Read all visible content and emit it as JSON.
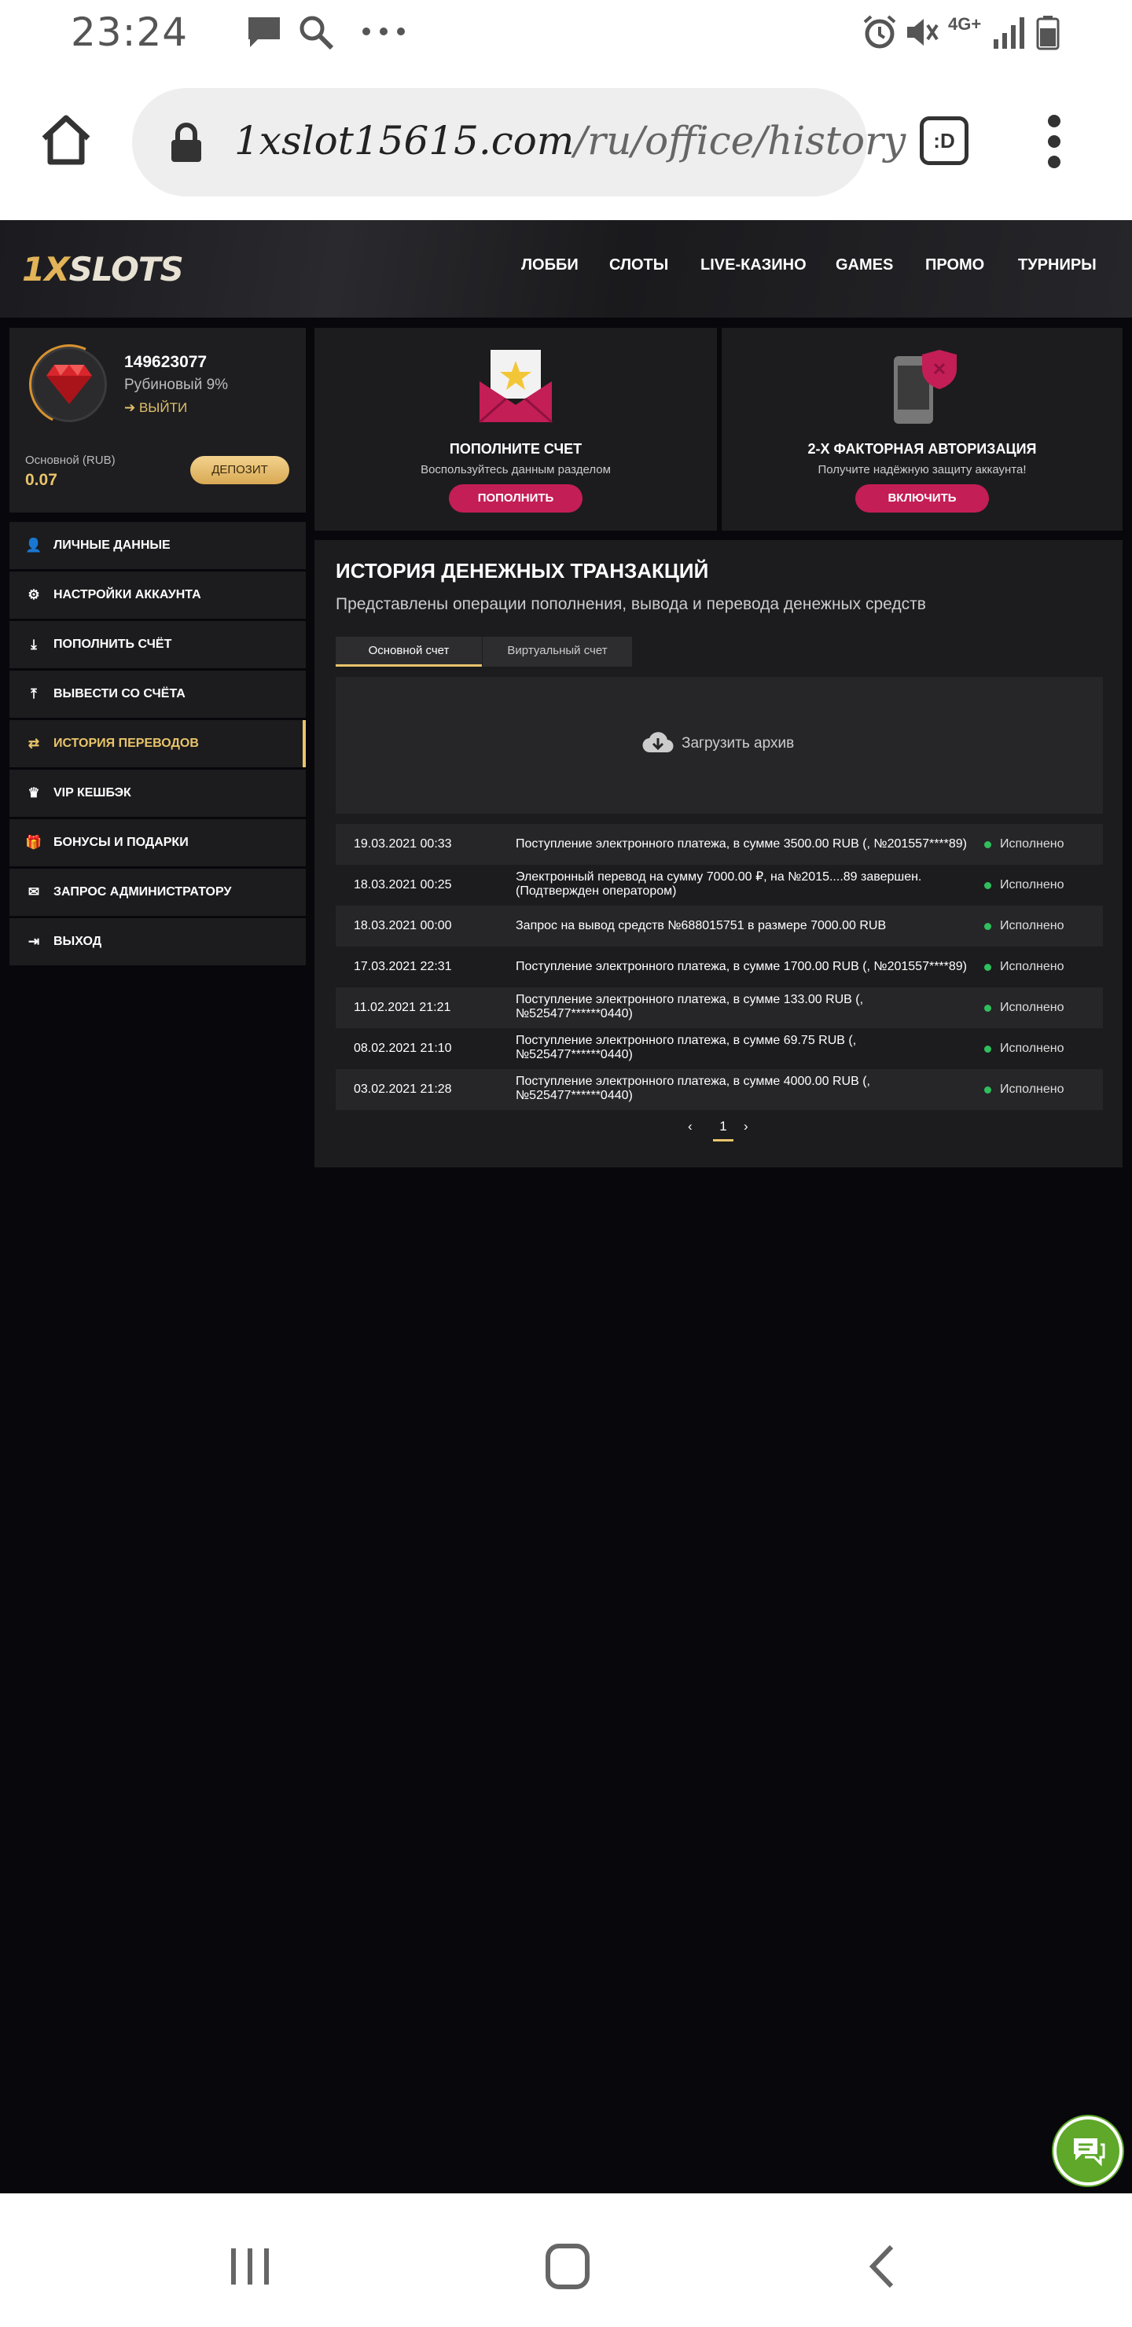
{
  "status_bar": {
    "time": "23:24",
    "network": "4G+"
  },
  "browser": {
    "url_host": "1xslot15615.com",
    "url_path": "/ru/office/history",
    "tab_icon": ":D"
  },
  "site": {
    "logo": {
      "prefix": "1X",
      "suffix": "SLOTS"
    },
    "nav": [
      "ЛОББИ",
      "СЛОТЫ",
      "LIVE-КАЗИНО",
      "GAMES",
      "ПРОМО",
      "ТУРНИРЫ"
    ],
    "accent_color": "#e8c46a",
    "button_color": "#c31e55",
    "success_color": "#2fbf5c"
  },
  "profile": {
    "user_id": "149623077",
    "rank": "Рубиновый 9%",
    "logout": "ВЫЙТИ",
    "balance_label": "Основной (RUB)",
    "balance_value": "0.07",
    "deposit_button": "ДЕПОЗИТ"
  },
  "menu": [
    {
      "label": "ЛИЧНЫЕ ДАННЫЕ",
      "icon": "user-plus-icon"
    },
    {
      "label": "НАСТРОЙКИ АККАУНТА",
      "icon": "gears-icon"
    },
    {
      "label": "ПОПОЛНИТЬ СЧЁТ",
      "icon": "download-icon"
    },
    {
      "label": "ВЫВЕСТИ СО СЧЁТА",
      "icon": "upload-icon"
    },
    {
      "label": "ИСТОРИЯ ПЕРЕВОДОВ",
      "icon": "exchange-icon",
      "active": true
    },
    {
      "label": "VIP КЕШБЭК",
      "icon": "crown-icon"
    },
    {
      "label": "БОНУСЫ И ПОДАРКИ",
      "icon": "gift-icon"
    },
    {
      "label": "ЗАПРОС АДМИНИСТРАТОРУ",
      "icon": "envelope-icon"
    },
    {
      "label": "ВЫХОД",
      "icon": "sign-out-icon"
    }
  ],
  "cards": {
    "deposit": {
      "title": "ПОПОЛНИТЕ СЧЕТ",
      "subtitle": "Воспользуйтесь данным разделом",
      "button": "ПОПОЛНИТЬ"
    },
    "twofa": {
      "title": "2-Х ФАКТОРНАЯ АВТОРИЗАЦИЯ",
      "subtitle": "Получите надёжную защиту аккаунта!",
      "button": "ВКЛЮЧИТЬ"
    }
  },
  "history": {
    "title": "ИСТОРИЯ ДЕНЕЖНЫХ ТРАНЗАКЦИЙ",
    "subtitle": "Представлены операции пополнения, вывода и перевода денежных средств",
    "tabs": [
      "Основной счет",
      "Виртуальный счет"
    ],
    "archive": "Загрузить архив",
    "rows": [
      {
        "date": "19.03.2021 00:33",
        "desc": "Поступление электронного платежа, в сумме 3500.00 RUB (, №201557****89)",
        "status": "Исполнено"
      },
      {
        "date": "18.03.2021 00:25",
        "desc": "Электронный перевод на сумму 7000.00 ₽, на №2015....89 завершен. (Подтвержден оператором)",
        "status": "Исполнено"
      },
      {
        "date": "18.03.2021 00:00",
        "desc": "Запрос на вывод средств №688015751 в размере 7000.00 RUB",
        "status": "Исполнено"
      },
      {
        "date": "17.03.2021 22:31",
        "desc": "Поступление электронного платежа, в сумме 1700.00 RUB (, №201557****89)",
        "status": "Исполнено"
      },
      {
        "date": "11.02.2021 21:21",
        "desc": "Поступление электронного платежа, в сумме 133.00 RUB (, №525477******0440)",
        "status": "Исполнено"
      },
      {
        "date": "08.02.2021 21:10",
        "desc": "Поступление электронного платежа, в сумме 69.75 RUB (, №525477******0440)",
        "status": "Исполнено"
      },
      {
        "date": "03.02.2021 21:28",
        "desc": "Поступление электронного платежа, в сумме 4000.00 RUB (, №525477******0440)",
        "status": "Исполнено"
      }
    ],
    "pager": {
      "prev": "‹",
      "page": "1",
      "next": "›"
    }
  }
}
